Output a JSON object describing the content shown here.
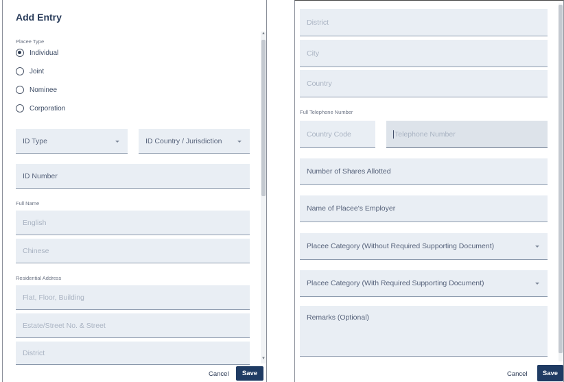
{
  "left_panel": {
    "title": "Add Entry",
    "placee_type_label": "Placee Type",
    "placee_types": [
      {
        "label": "Individual",
        "checked": true
      },
      {
        "label": "Joint",
        "checked": false
      },
      {
        "label": "Nominee",
        "checked": false
      },
      {
        "label": "Corporation",
        "checked": false
      }
    ],
    "id_type": "ID Type",
    "id_country": "ID Country / Jurisdiction",
    "id_number": "ID Number",
    "full_name_label": "Full Name",
    "english": "English",
    "chinese": "Chinese",
    "residential_address_label": "Residential Address",
    "flat_floor_building": "Flat, Floor, Building",
    "estate_street": "Estate/Street No. & Street",
    "district": "District",
    "cancel": "Cancel",
    "save": "Save"
  },
  "right_panel": {
    "district": "District",
    "city": "City",
    "country": "Country",
    "full_telephone_label": "Full Telephone Number",
    "country_code": "Country Code",
    "telephone_number": "Telephone Number",
    "number_of_shares": "Number of Shares Allotted",
    "employer": "Name of Placee's Employer",
    "category_without": "Placee Category (Without Required Supporting Document)",
    "category_with": "Placee Category (With Required Supporting Document)",
    "remarks": "Remarks (Optional)",
    "cancel": "Cancel",
    "save": "Save"
  },
  "colors": {
    "field_bg": "#e9eef4",
    "primary_button": "#1f3b63",
    "title_text": "#273a59"
  }
}
